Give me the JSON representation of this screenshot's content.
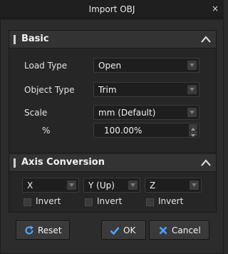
{
  "window": {
    "title": "Import OBJ",
    "close": "×"
  },
  "basic": {
    "title": "Basic",
    "load_type": {
      "label": "Load Type",
      "value": "Open"
    },
    "object_type": {
      "label": "Object Type",
      "value": "Trim"
    },
    "scale": {
      "label": "Scale",
      "value": "mm (Default)"
    },
    "percent": {
      "label": "%",
      "value": "100.00%"
    }
  },
  "axis": {
    "title": "Axis Conversion",
    "x": {
      "value": "X",
      "invert_label": "Invert"
    },
    "y": {
      "value": "Y (Up)",
      "invert_label": "Invert"
    },
    "z": {
      "value": "Z",
      "invert_label": "Invert"
    }
  },
  "buttons": {
    "reset": "Reset",
    "ok": "OK",
    "cancel": "Cancel"
  },
  "colors": {
    "accent": "#4da3ff",
    "background": "#2c2c2c",
    "field": "#1e1e1e"
  }
}
